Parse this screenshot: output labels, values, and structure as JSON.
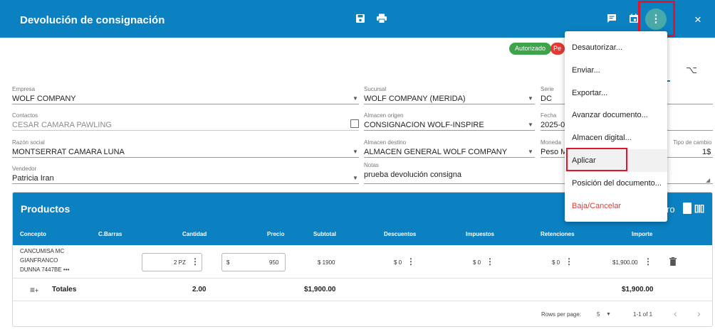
{
  "header": {
    "title": "Devolución de consignación",
    "icons": [
      "save-icon",
      "print-icon",
      "notes-icon",
      "calendar-icon",
      "more-vert-icon",
      "close-icon"
    ],
    "close": "×"
  },
  "badges": {
    "authorized": "Autorizado",
    "pending": "Pe",
    "colors": {
      "authorized": "#3ea44c",
      "pending": "#e53935"
    }
  },
  "form": {
    "empresa": {
      "label": "Empresa",
      "value": "WOLF COMPANY"
    },
    "contactos": {
      "label": "Contactos",
      "value": "CESAR CAMARA PAWLING"
    },
    "razon_social": {
      "label": "Razón social",
      "value": "MONTSERRAT CAMARA LUNA"
    },
    "vendedor": {
      "label": "Vendedor",
      "value": "Patricia Iran"
    },
    "sucursal": {
      "label": "Sucursal",
      "value": "WOLF COMPANY (MERIDA)"
    },
    "almacen_origen": {
      "label": "Almacen origen",
      "value": "CONSIGNACION WOLF-INSPIRE"
    },
    "almacen_destino": {
      "label": "Almacen destino",
      "value": "ALMACEN GENERAL WOLF COMPANY"
    },
    "notas": {
      "label": "Notas",
      "value": "prueba devolución consigna"
    },
    "serie": {
      "label": "Serie",
      "value": "DC"
    },
    "fecha": {
      "label": "Fecha",
      "value": "2025-0"
    },
    "moneda": {
      "label": "Moneda",
      "value": "Peso M"
    },
    "tipo_cambio": {
      "label": "Tipo de cambio",
      "value": "1$"
    }
  },
  "products": {
    "title": "Productos",
    "title_cut": "ro",
    "columns": [
      "Concepto",
      "C.Barras",
      "Cantidad",
      "Precio",
      "Subtotal",
      "Descuentos",
      "Impuestos",
      "Retenciones",
      "Importe"
    ],
    "row": {
      "concepto_lines": [
        "CANCUMISA MC",
        "GIANFRANCO",
        "DUNNA 7447BE •••"
      ],
      "cantidad": "2 PZ",
      "currency": "$",
      "precio": "950",
      "subtotal": "$ 1900",
      "descuentos": "$ 0",
      "impuestos": "$ 0",
      "retenciones": "$ 0",
      "importe": "$1,900.00"
    },
    "totals": {
      "label": "Totales",
      "cantidad": "2.00",
      "subtotal": "$1,900.00",
      "importe": "$1,900.00"
    },
    "footer": {
      "rows_per_page_label": "Rows per page:",
      "rows_per_page": "5",
      "range": "1-1 of 1"
    }
  },
  "menu": {
    "items": [
      "Desautorizar...",
      "Enviar...",
      "Exportar...",
      "Avanzar documento...",
      "Almacen digital...",
      "Aplicar",
      "Posición del documento...",
      "Baja/Cancelar"
    ]
  }
}
